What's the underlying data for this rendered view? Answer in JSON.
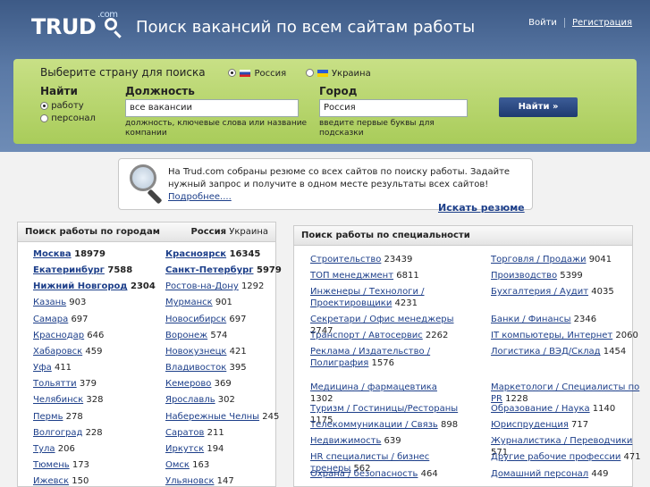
{
  "header": {
    "logo": "TRUD",
    "logo_com": ".com",
    "tagline": "Поиск вакансий по всем сайтам работы",
    "login": "Войти",
    "register": "Регистрация"
  },
  "search": {
    "country_title": "Выберите страну для поиска",
    "country_options": [
      "Россия",
      "Украина"
    ],
    "country_selected": "Россия",
    "find_label": "Найти",
    "find_options": [
      "работу",
      "персонал"
    ],
    "find_selected": "работу",
    "position_label": "Должность",
    "position_value": "все вакансии",
    "position_hint": "должность, ключевые слова или название компании",
    "city_label": "Город",
    "city_value": "Россия",
    "city_hint": "введите первые буквы для подсказки",
    "button": "Найти »"
  },
  "info": {
    "text": "На Trud.com собраны резюме со всех сайтов по поиску работы. Задайте нужный запрос и получите в одном месте результаты всех сайтов!",
    "more": "Подробнее....",
    "search_resume": "Искать резюме"
  },
  "cities": {
    "title": "Поиск работы по городам",
    "country_russia": "Россия",
    "country_ukraine": "Украина",
    "left": [
      {
        "name": "Москва",
        "count": "18979",
        "bold": true
      },
      {
        "name": "Екатеринбург",
        "count": "7588",
        "bold": true
      },
      {
        "name": "Нижний Новгород",
        "count": "2304",
        "bold": true
      },
      {
        "name": "Казань",
        "count": "903"
      },
      {
        "name": "Самара",
        "count": "697"
      },
      {
        "name": "Краснодар",
        "count": "646"
      },
      {
        "name": "Хабаровск",
        "count": "459"
      },
      {
        "name": "Уфа",
        "count": "411"
      },
      {
        "name": "Тольятти",
        "count": "379"
      },
      {
        "name": "Челябинск",
        "count": "328"
      },
      {
        "name": "Пермь",
        "count": "278"
      },
      {
        "name": "Волгоград",
        "count": "228"
      },
      {
        "name": "Тула",
        "count": "206"
      },
      {
        "name": "Тюмень",
        "count": "173"
      },
      {
        "name": "Ижевск",
        "count": "150"
      }
    ],
    "right": [
      {
        "name": "Красноярск",
        "count": "16345",
        "bold": true
      },
      {
        "name": "Санкт-Петербург",
        "count": "5979",
        "bold": true
      },
      {
        "name": "Ростов-на-Дону",
        "count": "1292"
      },
      {
        "name": "Мурманск",
        "count": "901"
      },
      {
        "name": "Новосибирск",
        "count": "697"
      },
      {
        "name": "Воронеж",
        "count": "574"
      },
      {
        "name": "Новокузнецк",
        "count": "421"
      },
      {
        "name": "Владивосток",
        "count": "395"
      },
      {
        "name": "Кемерово",
        "count": "369"
      },
      {
        "name": "Ярославль",
        "count": "302"
      },
      {
        "name": "Набережные Челны",
        "count": "245"
      },
      {
        "name": "Саратов",
        "count": "211"
      },
      {
        "name": "Иркутск",
        "count": "194"
      },
      {
        "name": "Омск",
        "count": "163"
      },
      {
        "name": "Ульяновск",
        "count": "147"
      }
    ]
  },
  "specialties": {
    "title": "Поиск работы по специальности",
    "left": [
      {
        "name": "Строительство",
        "count": "23439"
      },
      {
        "name": "ТОП менеджмент",
        "count": "6811"
      },
      {
        "name": "Инженеры / Технологи / Проектировщики",
        "count": "4231"
      },
      {
        "name": "Секретари / Офис менеджеры",
        "count": "2747"
      },
      {
        "name": "Транспорт / Автосервис",
        "count": "2262"
      },
      {
        "name": "Реклама / Издательство / Полиграфия",
        "count": "1576"
      },
      {
        "name": "Медицина / фармацевтика",
        "count": "1302"
      },
      {
        "name": "Туризм / Гостиницы/Рестораны",
        "count": "1175"
      },
      {
        "name": "Телекоммуникации / Связь",
        "count": "898"
      },
      {
        "name": "Недвижимость",
        "count": "639"
      },
      {
        "name": "HR специалисты / бизнес тренеры",
        "count": "562"
      },
      {
        "name": "Охрана / безопасность",
        "count": "464"
      }
    ],
    "right": [
      {
        "name": "Торговля / Продажи",
        "count": "9041"
      },
      {
        "name": "Производство",
        "count": "5399"
      },
      {
        "name": "Бухгалтерия / Аудит",
        "count": "4035"
      },
      {
        "name": "Банки / Финансы",
        "count": "2346"
      },
      {
        "name": "IT компьютеры, Интернет",
        "count": "2060"
      },
      {
        "name": "Логистика / ВЭД/Склад",
        "count": "1454"
      },
      {
        "name": "Маркетологи / Специалисты по PR",
        "count": "1228"
      },
      {
        "name": "Образование / Наука",
        "count": "1140"
      },
      {
        "name": "Юриспруденция",
        "count": "717"
      },
      {
        "name": "Журналистика / Переводчики",
        "count": "571"
      },
      {
        "name": "Другие рабочие профессии",
        "count": "471"
      },
      {
        "name": "Домашний персонал",
        "count": "449"
      }
    ]
  }
}
